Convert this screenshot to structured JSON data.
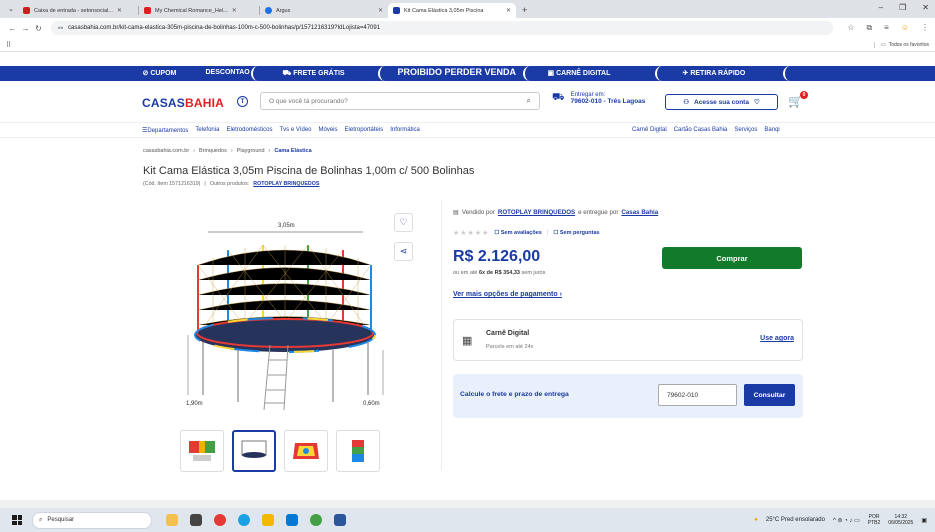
{
  "browser": {
    "tabs": [
      {
        "title": "Caixa de entrada - setonsocial...",
        "color": "#c5221f"
      },
      {
        "title": "My Chemical Romance_Hel...",
        "color": "#e02020"
      },
      {
        "title": "Argus",
        "color": "#1a73e8"
      },
      {
        "title": "Kit Cama Elástica 3,05m Piscina",
        "color": "#1a3aa6"
      }
    ],
    "url": "casasbahia.com.br/kit-cama-elastica-305m-piscina-de-bolinhas-100m-c-500-bolinhas/p/1571216319?IdLojista=47091",
    "bookmarks_all": "Todos os favoritos"
  },
  "promo": {
    "items": [
      "CUPOM",
      "DESCONTAO",
      "FRETE GRÁTIS",
      "PROIBIDO PERDER VENDA",
      "CARNÊ DIGITAL",
      "RETIRA RÁPIDO"
    ]
  },
  "header": {
    "logo_a": "CASAS",
    "logo_b": "BAHIA",
    "search_placeholder": "O que você tá procurando?",
    "deliver_label": "Entregar em:",
    "deliver_value": "79602-010 - Três Lagoas",
    "login_label": "Acesse sua conta",
    "cart_count": "0"
  },
  "catnav": {
    "left": [
      "Departamentos",
      "Telefonia",
      "Eletrodomésticos",
      "Tvs e Vídeo",
      "Móveis",
      "Eletroportáteis",
      "Informática"
    ],
    "right": [
      "Carnê Digital",
      "Cartão Casas Bahia",
      "Serviços",
      "Banqi"
    ]
  },
  "breadcrumb": [
    "casasbahia.com.br",
    "Brinquedos",
    "Playground",
    "Cama Elástica"
  ],
  "product": {
    "title": "Kit Cama Elástica 3,05m Piscina de Bolinhas 1,00m c/ 500 Bolinhas",
    "code": "(Cód. Item 1571216319)",
    "others": "Outros produtos:",
    "brand": "ROTOPLAY BRINQUEDOS",
    "dim_top": "3,05m",
    "dim_left": "1,90m",
    "dim_right": "0,60m"
  },
  "buy": {
    "sold_by": "Vendido por",
    "seller": "ROTOPLAY BRINQUEDOS",
    "delivered_by": "e entregue por",
    "deliverer": "Casas Bahia",
    "no_reviews": "Sem avaliações",
    "no_questions": "Sem perguntas",
    "price": "R$ 2.126,00",
    "install_pre": "ou em até",
    "install_bold": "6x de R$ 354,33",
    "install_post": "sem juros",
    "more_payment": "Ver mais opções de pagamento",
    "buy_label": "Comprar",
    "carne_title": "Carnê Digital",
    "carne_sub": "Parcele em até 24x",
    "carne_use": "Use agora",
    "frete_label": "Calcule o frete e prazo de entrega",
    "frete_value": "79602-010",
    "frete_button": "Consultar"
  },
  "taskbar": {
    "search": "Pesquisar",
    "weather": "25°C Pred ensolarado",
    "lang1": "POR",
    "lang2": "PTB2",
    "time": "14:32",
    "date": "06/05/2025"
  }
}
